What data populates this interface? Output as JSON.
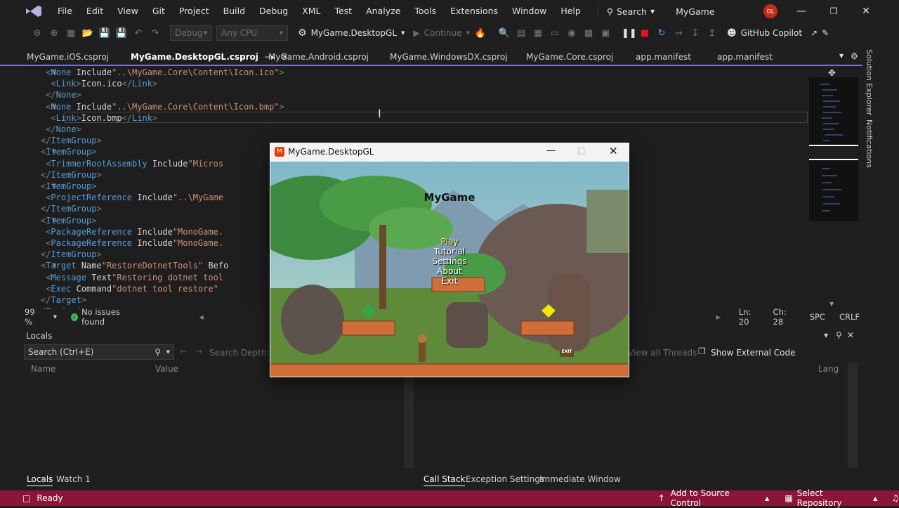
{
  "menubar": {
    "items": [
      "File",
      "Edit",
      "View",
      "Git",
      "Project",
      "Build",
      "Debug",
      "XML",
      "Test",
      "Analyze",
      "Tools",
      "Extensions",
      "Window",
      "Help"
    ],
    "search_label": "Search",
    "app_title": "MyGame",
    "avatar_initials": "DL"
  },
  "toolbar": {
    "config": "Debug",
    "platform": "Any CPU",
    "startup_project": "MyGame.DesktopGL",
    "continue_label": "Continue",
    "copilot_label": "GitHub Copilot"
  },
  "tabs": [
    {
      "label": "MyGame.iOS.csproj"
    },
    {
      "label": "MyGame.DesktopGL.csproj"
    },
    {
      "label": "MyGame.Android.csproj"
    },
    {
      "label": "MyGame.WindowsDX.csproj"
    },
    {
      "label": "MyGame.Core.csproj"
    },
    {
      "label": "app.manifest"
    },
    {
      "label": "app.manifest"
    }
  ],
  "editor": {
    "lines": [
      "<None Include=\"..\\MyGame.Core\\Content\\Icon.ico\">",
      "<Link>Icon.ico</Link>",
      "</None>",
      "<None Include=\"..\\MyGame.Core\\Content\\Icon.bmp\">",
      "<Link>Icon.bmp</Link>",
      "</None>",
      "</ItemGroup>",
      "<ItemGroup>",
      "<TrimmerRootAssembly Include=\"Micros",
      "</ItemGroup>",
      "<ItemGroup>",
      "<ProjectReference Include=\"..\\MyGame",
      "</ItemGroup>",
      "<ItemGroup>",
      "<PackageReference Include=\"MonoGame.",
      "<PackageReference Include=\"MonoGame.",
      "</ItemGroup>",
      "<Target Name=\"RestoreDotnetTools\" Befo",
      "<Message Text=\"Restoring dotnet tool",
      "<Exec Command=\"dotnet tool restore\"",
      "</Target>",
      "</Project>"
    ]
  },
  "side_labels": {
    "solution_explorer": "Solution Explorer",
    "notifications": "Notifications"
  },
  "editor_status": {
    "zoom": "99 %",
    "issues": "No issues found",
    "line": "Ln: 20",
    "char": "Ch: 28",
    "spacing": "SPC",
    "eol": "CRLF"
  },
  "locals": {
    "title": "Locals",
    "search_placeholder": "Search (Ctrl+E)",
    "search_depth_label": "Search Depth:",
    "col_name": "Name",
    "col_value": "Value"
  },
  "callstack": {
    "view_threads": "View all Threads",
    "show_external": "Show External Code",
    "col_lang": "Lang"
  },
  "bottom_tabs": {
    "left": [
      "Locals",
      "Watch 1"
    ],
    "right": [
      "Call Stack",
      "Exception Settings",
      "Immediate Window"
    ]
  },
  "statusbar": {
    "ready": "Ready",
    "source_control": "Add to Source Control",
    "repository": "Select Repository"
  },
  "game": {
    "window_title": "MyGame.DesktopGL",
    "title": "MyGame",
    "menu": [
      "Play",
      "Tutorial",
      "Settings",
      "About",
      "Exit"
    ],
    "exit_sign": "EXIT"
  },
  "colors": {
    "accent": "#7c6fd6",
    "statusbar": "#8a1538",
    "menu_selected": "#ffff66"
  }
}
